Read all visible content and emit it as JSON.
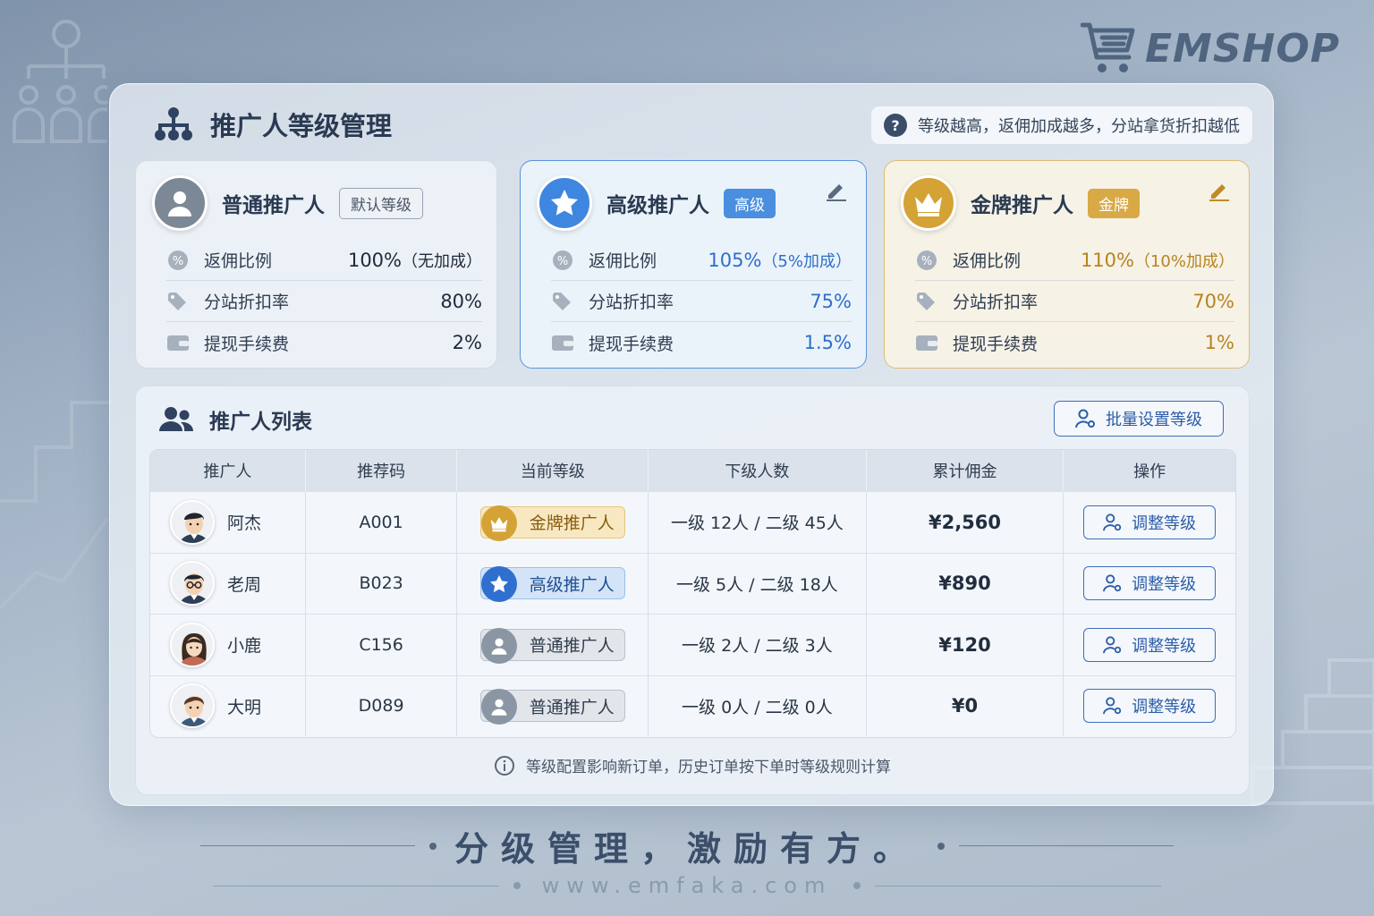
{
  "brand": {
    "logo": "EMSHOP"
  },
  "panel": {
    "title": "推广人等级管理",
    "hint": "等级越高，返佣加成越多，分站拿货折扣越低"
  },
  "levels": [
    {
      "name": "普通推广人",
      "badge": "默认等级",
      "rows": [
        {
          "label": "返佣比例",
          "value": "100%",
          "note": "（无加成）",
          "icon": "percent-icon"
        },
        {
          "label": "分站折扣率",
          "value": "80%",
          "icon": "tag-icon"
        },
        {
          "label": "提现手续费",
          "value": "2%",
          "icon": "wallet-icon"
        }
      ]
    },
    {
      "name": "高级推广人",
      "badge": "高级",
      "rows": [
        {
          "label": "返佣比例",
          "value": "105%",
          "note": "（5%加成）",
          "icon": "percent-icon"
        },
        {
          "label": "分站折扣率",
          "value": "75%",
          "icon": "tag-icon"
        },
        {
          "label": "提现手续费",
          "value": "1.5%",
          "icon": "wallet-icon"
        }
      ]
    },
    {
      "name": "金牌推广人",
      "badge": "金牌",
      "rows": [
        {
          "label": "返佣比例",
          "value": "110%",
          "note": "（10%加成）",
          "icon": "percent-icon"
        },
        {
          "label": "分站折扣率",
          "value": "70%",
          "icon": "tag-icon"
        },
        {
          "label": "提现手续费",
          "value": "1%",
          "icon": "wallet-icon"
        }
      ]
    }
  ],
  "list": {
    "title": "推广人列表",
    "batch_button": "批量设置等级",
    "columns": [
      "推广人",
      "推荐码",
      "当前等级",
      "下级人数",
      "累计佣金",
      "操作"
    ],
    "rows": [
      {
        "name": "阿杰",
        "code": "A001",
        "level": "金牌推广人",
        "level_type": "gold",
        "subs": "一级 12人 / 二级 45人",
        "commission": "¥2,560",
        "action": "调整等级"
      },
      {
        "name": "老周",
        "code": "B023",
        "level": "高级推广人",
        "level_type": "adv",
        "subs": "一级 5人 / 二级 18人",
        "commission": "¥890",
        "action": "调整等级"
      },
      {
        "name": "小鹿",
        "code": "C156",
        "level": "普通推广人",
        "level_type": "norm",
        "subs": "一级 2人 / 二级 3人",
        "commission": "¥120",
        "action": "调整等级"
      },
      {
        "name": "大明",
        "code": "D089",
        "level": "普通推广人",
        "level_type": "norm",
        "subs": "一级 0人 / 二级 0人",
        "commission": "¥0",
        "action": "调整等级"
      }
    ],
    "footnote": "等级配置影响新订单，历史订单按下单时等级规则计算"
  },
  "slogan": "分级管理，激励有方。",
  "url": "www.emfaka.com",
  "colors": {
    "advanced": "#4a8ee0",
    "gold": "#d8a945",
    "accent_button": "#2c5da8"
  }
}
